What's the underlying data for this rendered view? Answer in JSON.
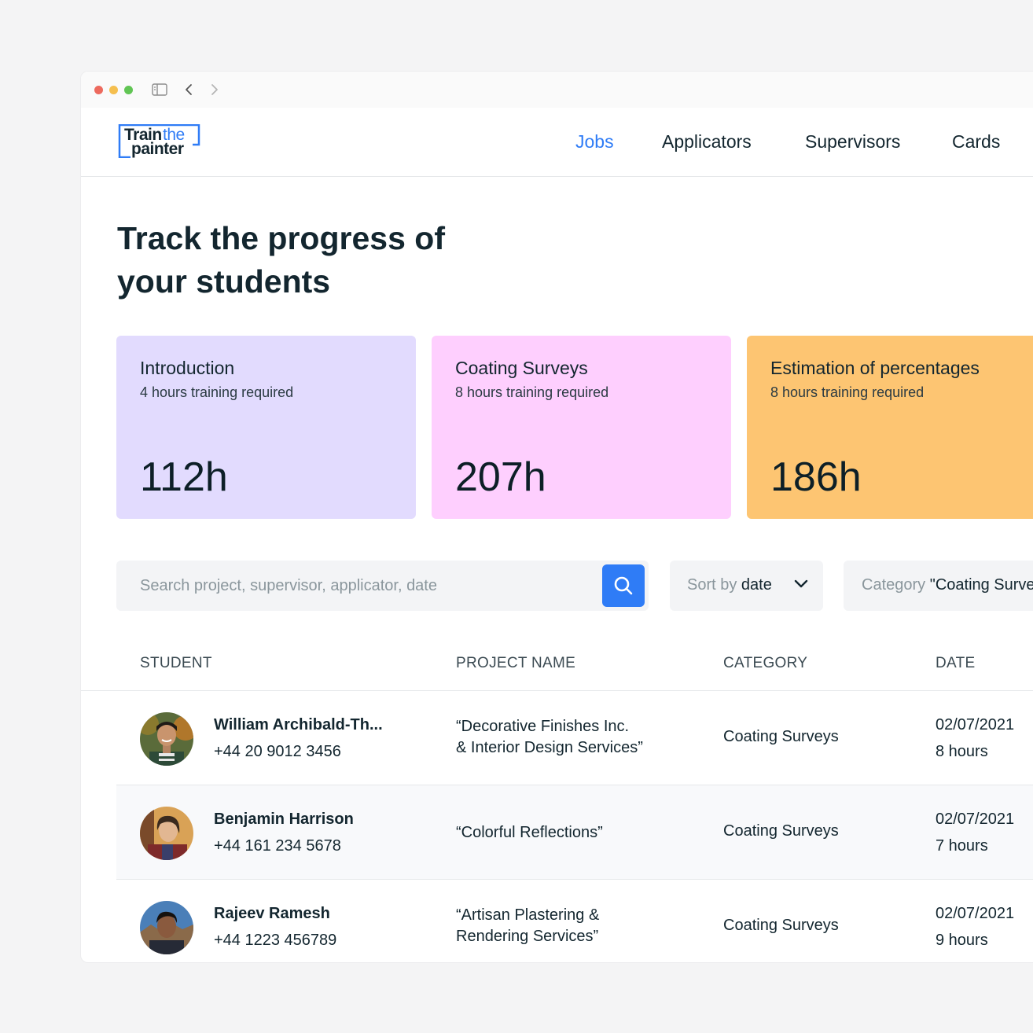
{
  "browser": {
    "sidebar_icon": "sidebar-icon",
    "back_icon": "chevron-left-icon",
    "forward_icon": "chevron-right-icon"
  },
  "logo": {
    "train": "Train",
    "the": "the",
    "painter": "painter"
  },
  "nav": {
    "items": [
      {
        "label": "Jobs",
        "active": true
      },
      {
        "label": "Applicators",
        "active": false
      },
      {
        "label": "Supervisors",
        "active": false
      },
      {
        "label": "Cards",
        "active": false
      }
    ]
  },
  "hero": {
    "title": "Track the progress of your students"
  },
  "cards": [
    {
      "title": "Introduction",
      "subtitle": "4 hours training required",
      "value": "112h",
      "color": "#e2dbfe"
    },
    {
      "title": "Coating Surveys",
      "subtitle": "8 hours training required",
      "value": "207h",
      "color": "#fecffe"
    },
    {
      "title": "Estimation of percentages",
      "subtitle": "8 hours training required",
      "value": "186h",
      "color": "#fdc572"
    }
  ],
  "filters": {
    "search_placeholder": "Search project, supervisor, applicator, date",
    "search_icon": "search-icon",
    "sort_prefix": "Sort by",
    "sort_value": "date",
    "category_prefix": "Category",
    "category_value": "\"Coating Surveys\""
  },
  "table": {
    "headers": [
      "STUDENT",
      "PROJECT NAME",
      "CATEGORY",
      "DATE"
    ],
    "rows": [
      {
        "name": "William Archibald-Th...",
        "phone": "+44 20 9012 3456",
        "project": "“Decorative Finishes Inc.\n& Interior Design Services”",
        "category": "Coating Surveys",
        "date": "02/07/2021",
        "hours": "8 hours"
      },
      {
        "name": "Benjamin Harrison",
        "phone": "+44 161 234 5678",
        "project": "“Colorful Reflections”",
        "category": "Coating Surveys",
        "date": "02/07/2021",
        "hours": "7 hours"
      },
      {
        "name": "Rajeev Ramesh",
        "phone": "+44 1223 456789",
        "project": "“Artisan Plastering &\nRendering Services”",
        "category": "Coating Surveys",
        "date": "02/07/2021",
        "hours": "9 hours"
      }
    ]
  },
  "colors": {
    "accent": "#2f7cf6",
    "text": "#13262f"
  }
}
